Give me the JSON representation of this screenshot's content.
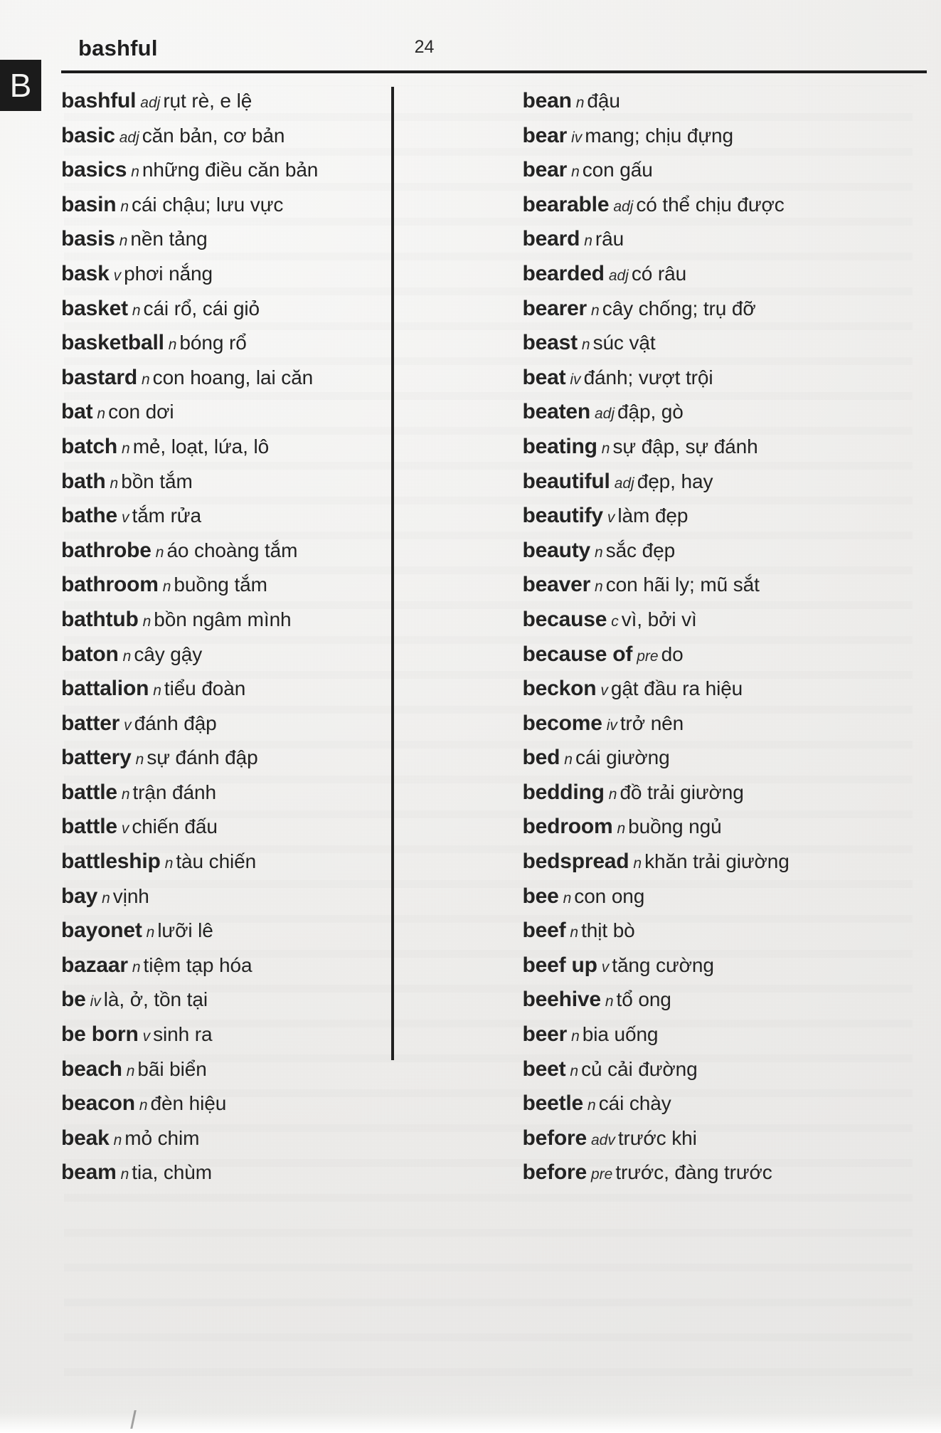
{
  "header": {
    "running_head": "bashful",
    "page_number": "24",
    "tab_letter": "B"
  },
  "columns": {
    "left": [
      {
        "headword": "bashful",
        "pos": "adj",
        "gloss": "rụt rè, e lệ"
      },
      {
        "headword": "basic",
        "pos": "adj",
        "gloss": "căn bản, cơ bản"
      },
      {
        "headword": "basics",
        "pos": "n",
        "gloss": "những điều căn bản"
      },
      {
        "headword": "basin",
        "pos": "n",
        "gloss": "cái chậu; lưu vực"
      },
      {
        "headword": "basis",
        "pos": "n",
        "gloss": "nền tảng"
      },
      {
        "headword": "bask",
        "pos": "v",
        "gloss": "phơi nắng"
      },
      {
        "headword": "basket",
        "pos": "n",
        "gloss": "cái rổ, cái giỏ"
      },
      {
        "headword": "basketball",
        "pos": "n",
        "gloss": "bóng rổ"
      },
      {
        "headword": "bastard",
        "pos": "n",
        "gloss": "con hoang, lai căn"
      },
      {
        "headword": "bat",
        "pos": "n",
        "gloss": "con dơi"
      },
      {
        "headword": "batch",
        "pos": "n",
        "gloss": "mẻ, loạt, lứa, lô"
      },
      {
        "headword": "bath",
        "pos": "n",
        "gloss": "bồn tắm"
      },
      {
        "headword": "bathe",
        "pos": "v",
        "gloss": "tắm rửa"
      },
      {
        "headword": "bathrobe",
        "pos": "n",
        "gloss": "áo choàng tắm"
      },
      {
        "headword": "bathroom",
        "pos": "n",
        "gloss": "buồng tắm"
      },
      {
        "headword": "bathtub",
        "pos": "n",
        "gloss": "bồn ngâm mình"
      },
      {
        "headword": "baton",
        "pos": "n",
        "gloss": "cây gậy"
      },
      {
        "headword": "battalion",
        "pos": "n",
        "gloss": "tiểu đoàn"
      },
      {
        "headword": "batter",
        "pos": "v",
        "gloss": "đánh đập"
      },
      {
        "headword": "battery",
        "pos": "n",
        "gloss": "sự đánh đập"
      },
      {
        "headword": "battle",
        "pos": "n",
        "gloss": "trận đánh"
      },
      {
        "headword": "battle",
        "pos": "v",
        "gloss": "chiến đấu"
      },
      {
        "headword": "battleship",
        "pos": "n",
        "gloss": "tàu chiến"
      },
      {
        "headword": "bay",
        "pos": "n",
        "gloss": "vịnh"
      },
      {
        "headword": "bayonet",
        "pos": "n",
        "gloss": "lưỡi lê"
      },
      {
        "headword": "bazaar",
        "pos": "n",
        "gloss": "tiệm tạp hóa"
      },
      {
        "headword": "be",
        "pos": "iv",
        "gloss": "là, ở, tồn tại"
      },
      {
        "headword": "be born",
        "pos": "v",
        "gloss": "sinh ra"
      },
      {
        "headword": "beach",
        "pos": "n",
        "gloss": "bãi biển"
      },
      {
        "headword": "beacon",
        "pos": "n",
        "gloss": "đèn hiệu"
      },
      {
        "headword": "beak",
        "pos": "n",
        "gloss": "mỏ chim"
      },
      {
        "headword": "beam",
        "pos": "n",
        "gloss": "tia, chùm"
      }
    ],
    "right": [
      {
        "headword": "bean",
        "pos": "n",
        "gloss": "đậu"
      },
      {
        "headword": "bear",
        "pos": "iv",
        "gloss": "mang; chịu đựng"
      },
      {
        "headword": "bear",
        "pos": "n",
        "gloss": "con gấu"
      },
      {
        "headword": "bearable",
        "pos": "adj",
        "gloss": "có thể chịu được"
      },
      {
        "headword": "beard",
        "pos": "n",
        "gloss": "râu"
      },
      {
        "headword": "bearded",
        "pos": "adj",
        "gloss": "có râu"
      },
      {
        "headword": "bearer",
        "pos": "n",
        "gloss": "cây chống; trụ đỡ"
      },
      {
        "headword": "beast",
        "pos": "n",
        "gloss": "súc vật"
      },
      {
        "headword": "beat",
        "pos": "iv",
        "gloss": "đánh; vượt trội"
      },
      {
        "headword": "beaten",
        "pos": "adj",
        "gloss": "đập, gò"
      },
      {
        "headword": "beating",
        "pos": "n",
        "gloss": "sự đập, sự đánh"
      },
      {
        "headword": "beautiful",
        "pos": "adj",
        "gloss": "đẹp, hay"
      },
      {
        "headword": "beautify",
        "pos": "v",
        "gloss": "làm đẹp"
      },
      {
        "headword": "beauty",
        "pos": "n",
        "gloss": "sắc đẹp"
      },
      {
        "headword": "beaver",
        "pos": "n",
        "gloss": "con hãi ly; mũ sắt"
      },
      {
        "headword": "because",
        "pos": "c",
        "gloss": "vì, bởi vì"
      },
      {
        "headword": "because of",
        "pos": "pre",
        "gloss": "do"
      },
      {
        "headword": "beckon",
        "pos": "v",
        "gloss": "gật đầu ra hiệu"
      },
      {
        "headword": "become",
        "pos": "iv",
        "gloss": "trở nên"
      },
      {
        "headword": "bed",
        "pos": "n",
        "gloss": "cái giường"
      },
      {
        "headword": "bedding",
        "pos": "n",
        "gloss": "đồ trải giường"
      },
      {
        "headword": "bedroom",
        "pos": "n",
        "gloss": "buồng ngủ"
      },
      {
        "headword": "bedspread",
        "pos": "n",
        "gloss": "khăn trải giường"
      },
      {
        "headword": "bee",
        "pos": "n",
        "gloss": "con ong"
      },
      {
        "headword": "beef",
        "pos": "n",
        "gloss": "thịt bò"
      },
      {
        "headword": "beef up",
        "pos": "v",
        "gloss": "tăng cường"
      },
      {
        "headword": "beehive",
        "pos": "n",
        "gloss": "tổ ong"
      },
      {
        "headword": "beer",
        "pos": "n",
        "gloss": "bia uống"
      },
      {
        "headword": "beet",
        "pos": "n",
        "gloss": "củ cải đường"
      },
      {
        "headword": "beetle",
        "pos": "n",
        "gloss": "cái chày"
      },
      {
        "headword": "before",
        "pos": "adv",
        "gloss": "trước khi"
      },
      {
        "headword": "before",
        "pos": "pre",
        "gloss": "trước, đàng trước"
      }
    ]
  }
}
